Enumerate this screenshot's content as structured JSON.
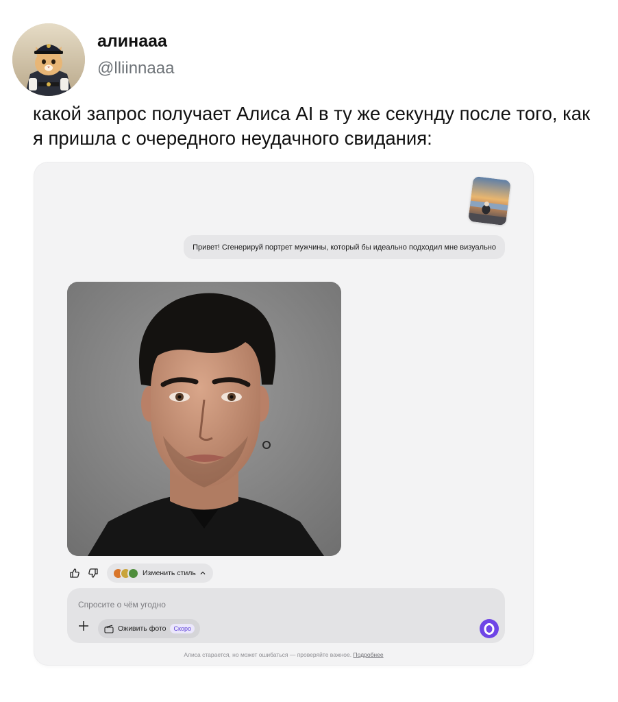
{
  "tweet": {
    "display_name": "алинааа",
    "handle": "@lliinnaaa",
    "avatar": "cat-in-police-costume-avatar",
    "text": "какой запрос получает Алиса AI в ту же секунду после того, как я пришла с очередного неудачного свидания:"
  },
  "chat": {
    "user_attachment": "beach-photo-thumbnail",
    "user_message": "Привет! Сгенерируй портрет мужчины, который бы идеально подходил мне визуально",
    "generated_image": "portrait-of-dark-haired-man",
    "actions": {
      "like_icon": "thumb-up-icon",
      "dislike_icon": "thumb-down-icon",
      "style_button_label": "Изменить стиль",
      "style_colors": [
        "#d9762a",
        "#c9a43a",
        "#4f8d3c"
      ]
    },
    "input": {
      "placeholder": "Спросите о чём угодно",
      "animate_label": "Оживить фото",
      "soon_badge": "Скоро",
      "accent_color": "#6f45e6"
    },
    "disclaimer": {
      "text": "Алиса старается, но может ошибаться — проверяйте важное.",
      "link": "Подробнее"
    }
  }
}
